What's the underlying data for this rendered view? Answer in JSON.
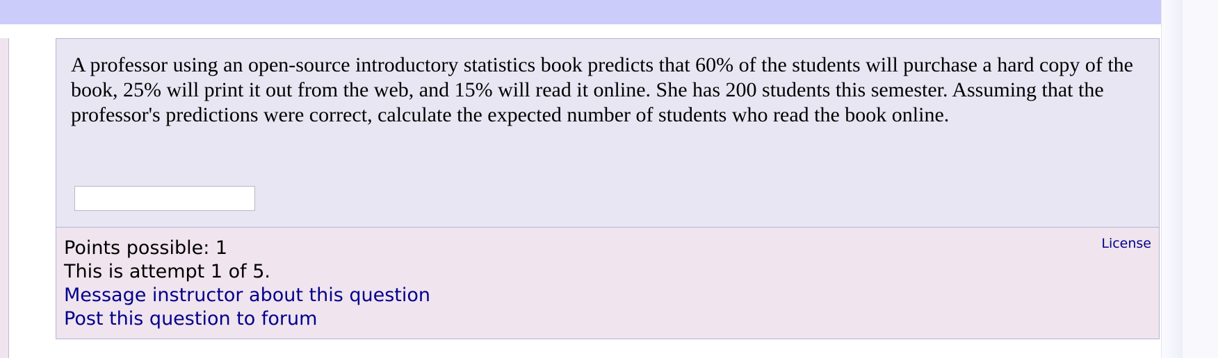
{
  "question": {
    "text": "A professor using an open-source introductory statistics book predicts that 60% of the students will purchase a hard copy of the book, 25% will print it out from the web, and 15% will read it online. She has 200 students this semester. Assuming that the professor's predictions were correct, calculate the expected number of students who read the book online.",
    "answer_value": ""
  },
  "footer": {
    "points_possible": "Points possible: 1",
    "attempt": "This is attempt 1 of 5.",
    "message_instructor": "Message instructor about this question",
    "post_forum": "Post this question to forum",
    "license": "License"
  },
  "colors": {
    "top_band": "#ccccfa",
    "question_bg": "#e8e6f2",
    "footer_bg": "#f0e4ee",
    "border": "#b5b3d6",
    "link": "#00008b"
  }
}
